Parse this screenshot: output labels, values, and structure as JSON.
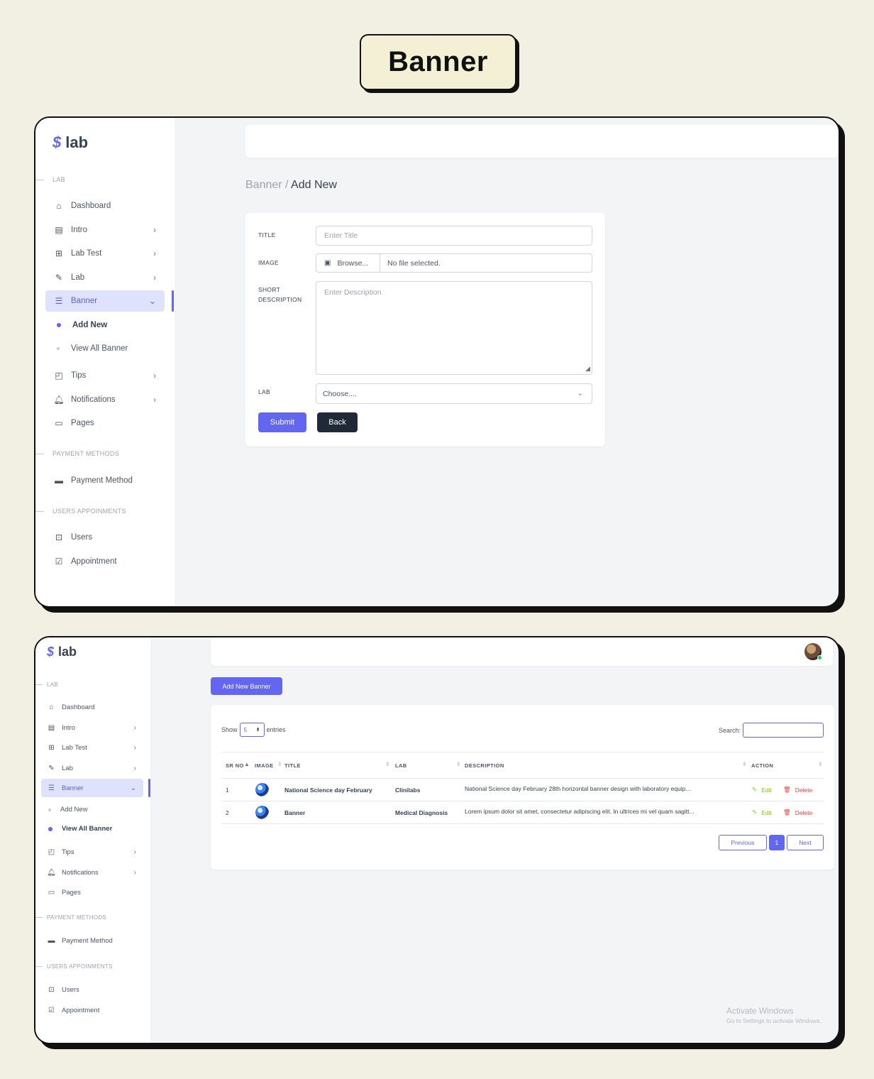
{
  "heading": "Banner",
  "brand": {
    "mark": "$",
    "name": "lab"
  },
  "sidebar": {
    "sections": {
      "lab": "LAB",
      "payment": "PAYMENT METHODS",
      "users": "USERS APPOINMENTS"
    },
    "items": {
      "dashboard": "Dashboard",
      "intro": "Intro",
      "lab_test": "Lab Test",
      "lab": "Lab",
      "banner": "Banner",
      "add_new": "Add New",
      "view_all_banner": "View All Banner",
      "tips": "Tips",
      "notifications": "Notifications",
      "pages": "Pages",
      "payment_method": "Payment Method",
      "users": "Users",
      "appointment": "Appointment"
    },
    "icons": [
      "home-icon",
      "layout-icon",
      "grid-icon",
      "pencil-icon",
      "sliders-icon",
      "note-icon",
      "bell-icon",
      "page-icon",
      "credit-card-icon",
      "user-badge-icon",
      "calendar-check-icon"
    ]
  },
  "form_page": {
    "breadcrumb": {
      "parent": "Banner",
      "sep": " / ",
      "current": "Add New"
    },
    "fields": {
      "title_label": "TITLE",
      "title_placeholder": "Enter Title",
      "image_label": "IMAGE",
      "browse_label": "Browse...",
      "no_file": "No file selected.",
      "desc_label_1": "SHORT",
      "desc_label_2": "DESCRIPTION",
      "desc_placeholder": "Enter Description",
      "lab_label": "LAB",
      "lab_selected": "Choose...."
    },
    "buttons": {
      "submit": "Submit",
      "back": "Back"
    }
  },
  "list_page": {
    "add_button": "Add New Banner",
    "show": {
      "prefix": "Show",
      "value": "5",
      "suffix": "entries"
    },
    "search_label": "Search:",
    "columns": [
      "SR NO",
      "IMAGE",
      "TITLE",
      "LAB",
      "DESCRIPTION",
      "ACTION"
    ],
    "rows": [
      {
        "sr": "1",
        "title": "National Science day February",
        "lab": "Clinilabs",
        "description": "National Science day February 28th horizontal banner design with laboratory equip...",
        "edit": "Edit",
        "delete": "Delete"
      },
      {
        "sr": "2",
        "title": "Banner",
        "lab": "Medical Diagnosis",
        "description": "Lorem ipsum dolor sit amet, consectetur adipiscing elit. In ultrices mi vel quam sagitt...",
        "edit": "Edit",
        "delete": "Delete"
      }
    ],
    "pagination": {
      "previous": "Previous",
      "current": "1",
      "next": "Next"
    },
    "watermark": {
      "line1": "Activate Windows",
      "line2": "Go to Settings to activate Windows."
    }
  },
  "colors": {
    "accent": "#6366f1",
    "dark_button": "#1f2937",
    "edit": "#84cc16",
    "delete": "#ef4444",
    "page_bg": "#f2efe3"
  }
}
